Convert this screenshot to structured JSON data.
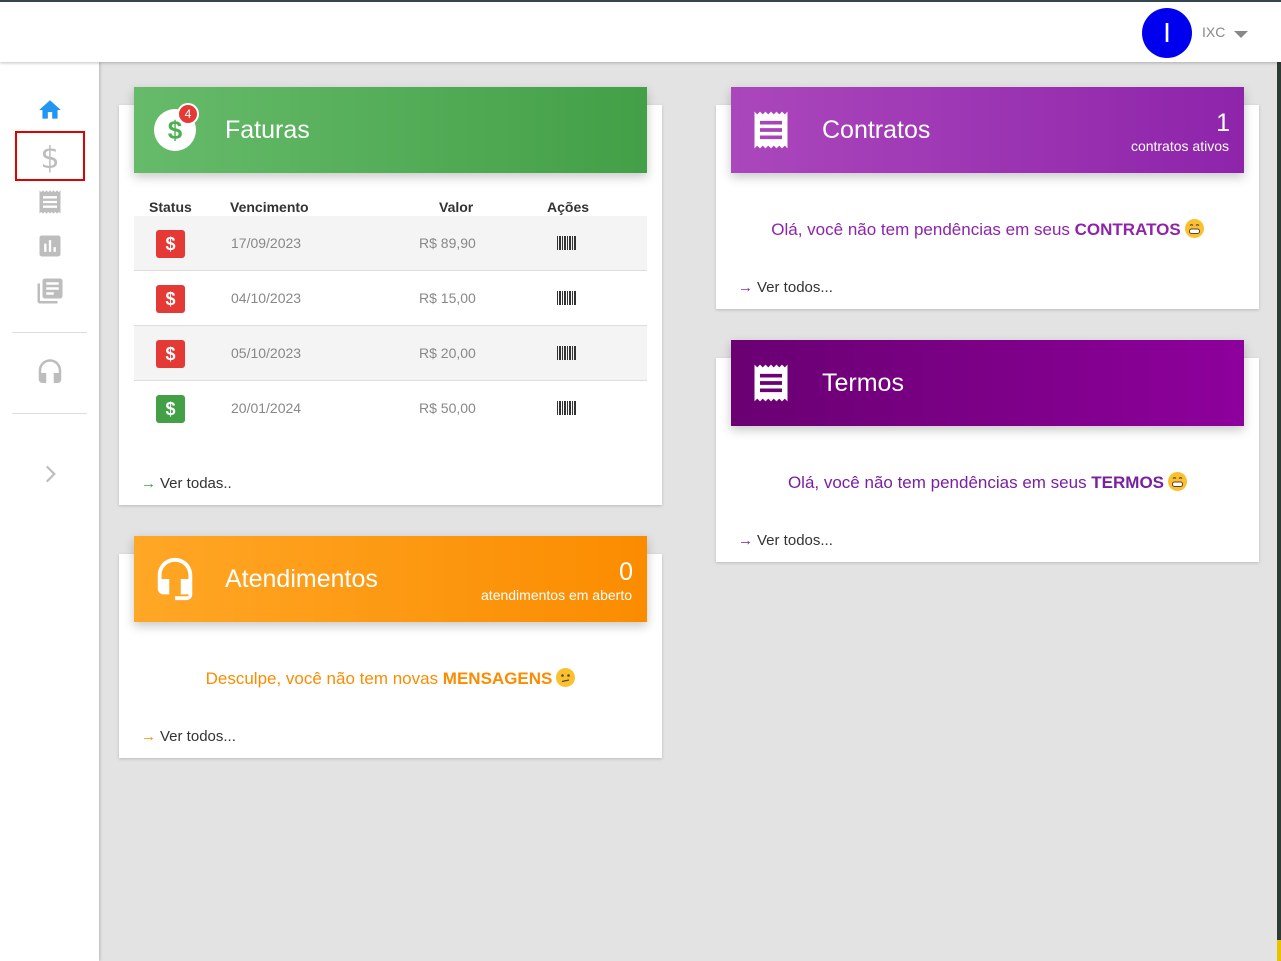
{
  "header": {
    "avatar_initial": "I",
    "user_name": "IXC"
  },
  "sidebar": {
    "items": [
      {
        "name": "home",
        "icon": "home-icon"
      },
      {
        "name": "financeiro",
        "icon": "dollar-icon",
        "glyph": "$"
      },
      {
        "name": "contratos",
        "icon": "receipt-icon"
      },
      {
        "name": "consumo",
        "icon": "bar-chart-icon"
      },
      {
        "name": "termos",
        "icon": "library-books-icon"
      },
      {
        "name": "atendimentos",
        "icon": "headset-icon"
      },
      {
        "name": "expand",
        "icon": "chevron-right-icon"
      }
    ]
  },
  "faturas": {
    "title": "Faturas",
    "badge": "4",
    "columns": [
      "Status",
      "Vencimento",
      "Valor",
      "Ações"
    ],
    "rows": [
      {
        "status": "open",
        "status_glyph": "$",
        "date": "17/09/2023",
        "value": "R$ 89,90"
      },
      {
        "status": "open",
        "status_glyph": "$",
        "date": "04/10/2023",
        "value": "R$ 15,00"
      },
      {
        "status": "open",
        "status_glyph": "$",
        "date": "05/10/2023",
        "value": "R$ 20,00"
      },
      {
        "status": "paid",
        "status_glyph": "$",
        "date": "20/01/2024",
        "value": "R$ 50,00"
      }
    ],
    "link": "Ver todas.."
  },
  "atendimentos": {
    "title": "Atendimentos",
    "count": "0",
    "count_label": "atendimentos em aberto",
    "msg_prefix": "Desculpe, você não tem novas ",
    "msg_strong": "MENSAGENS",
    "link": "Ver todos..."
  },
  "contratos": {
    "title": "Contratos",
    "count": "1",
    "count_label": "contratos ativos",
    "msg_prefix": "Olá, você não tem pendências em seus ",
    "msg_strong": "CONTRATOS",
    "link": "Ver todos..."
  },
  "termos": {
    "title": "Termos",
    "msg_prefix": "Olá, você não tem pendências em seus ",
    "msg_strong": "TERMOS",
    "link": "Ver todos..."
  },
  "link_arrow": "→",
  "colors": {
    "home_blue": "#2196f3",
    "green": "#43a047",
    "status_open": "#e53935",
    "status_paid": "#43a047",
    "purple": "#8e24aa",
    "termos_purple": "#7b1fa2",
    "orange": "#fb8c00",
    "avatar": "#0000ee"
  }
}
